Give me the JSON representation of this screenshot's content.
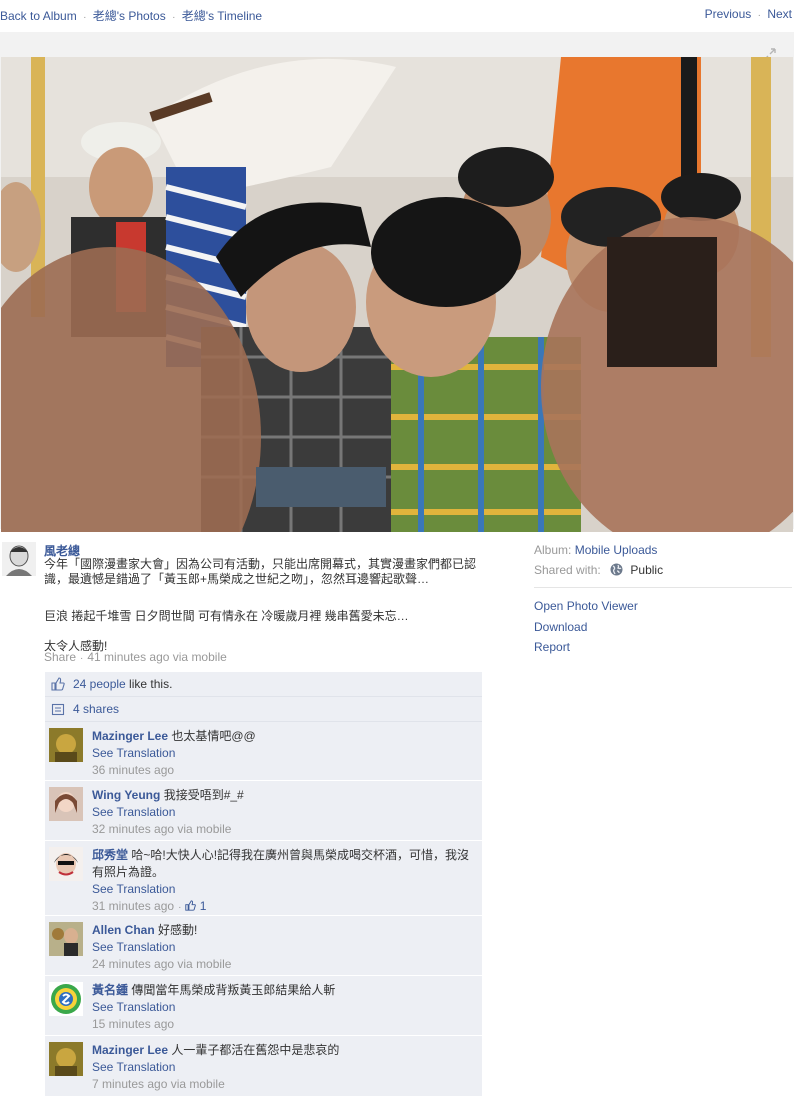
{
  "nav": {
    "back_to_album": "Back to Album",
    "owner_photos": "老總's Photos",
    "owner_timeline": "老總's Timeline",
    "separator": "·",
    "previous": "Previous",
    "next": "Next"
  },
  "post": {
    "owner_name": "風老總",
    "caption_1": "今年「國際漫畫家大會」因為公司有活動，只能出席開幕式，其實漫畫家們都已認識，最遺憾是錯過了「黃玉郎+馬榮成之世紀之吻」，忽然耳邊響起歌聲…",
    "caption_2": "巨浪 捲起千堆雪 日夕問世間 可有情永在 冷暖歲月裡 幾串舊愛未忘…",
    "caption_3": "太令人感動!",
    "share": "Share",
    "time": "41 minutes ago via mobile"
  },
  "ufi": {
    "likes_link": "24 people",
    "likes_suffix": " like this.",
    "shares": "4 shares"
  },
  "comments": [
    {
      "name": "Mazinger Lee",
      "text": "也太基情吧@@",
      "translate": "See Translation",
      "time": "36 minutes ago"
    },
    {
      "name": "Wing Yeung",
      "text": "我接受唔到#_#",
      "translate": "See Translation",
      "time": "32 minutes ago via mobile"
    },
    {
      "name": "邱秀堂",
      "text": "哈~哈!大快人心!記得我在廣州曾與馬榮成喝交杯酒，可惜，我沒有照片為證。",
      "translate": "See Translation",
      "time": "31 minutes ago",
      "likes": "1"
    },
    {
      "name": "Allen Chan",
      "text": "好感動!",
      "translate": "See Translation",
      "time": "24 minutes ago via mobile"
    },
    {
      "name": "黃名鍾",
      "text": "傳聞當年馬榮成背叛黃玉郎結果給人斬",
      "translate": "See Translation",
      "time": "15 minutes ago"
    },
    {
      "name": "Mazinger Lee",
      "text": "人一輩子都活在舊怨中是悲哀的",
      "translate": "See Translation",
      "time": "7 minutes ago via mobile"
    }
  ],
  "sidebar": {
    "album_label": "Album:",
    "album_value": "Mobile Uploads",
    "shared_label": "Shared with:",
    "shared_value": "Public",
    "open_viewer": "Open Photo Viewer",
    "download": "Download",
    "report": "Report"
  },
  "icons": {
    "expand": "expand-icon",
    "like": "thumbs-up-icon",
    "share": "share-icon",
    "globe": "globe-icon"
  },
  "colors": {
    "link": "#3b5998",
    "muted": "#999999",
    "ufi_bg": "#edeff4",
    "stage_bg": "#f2f2f2"
  }
}
